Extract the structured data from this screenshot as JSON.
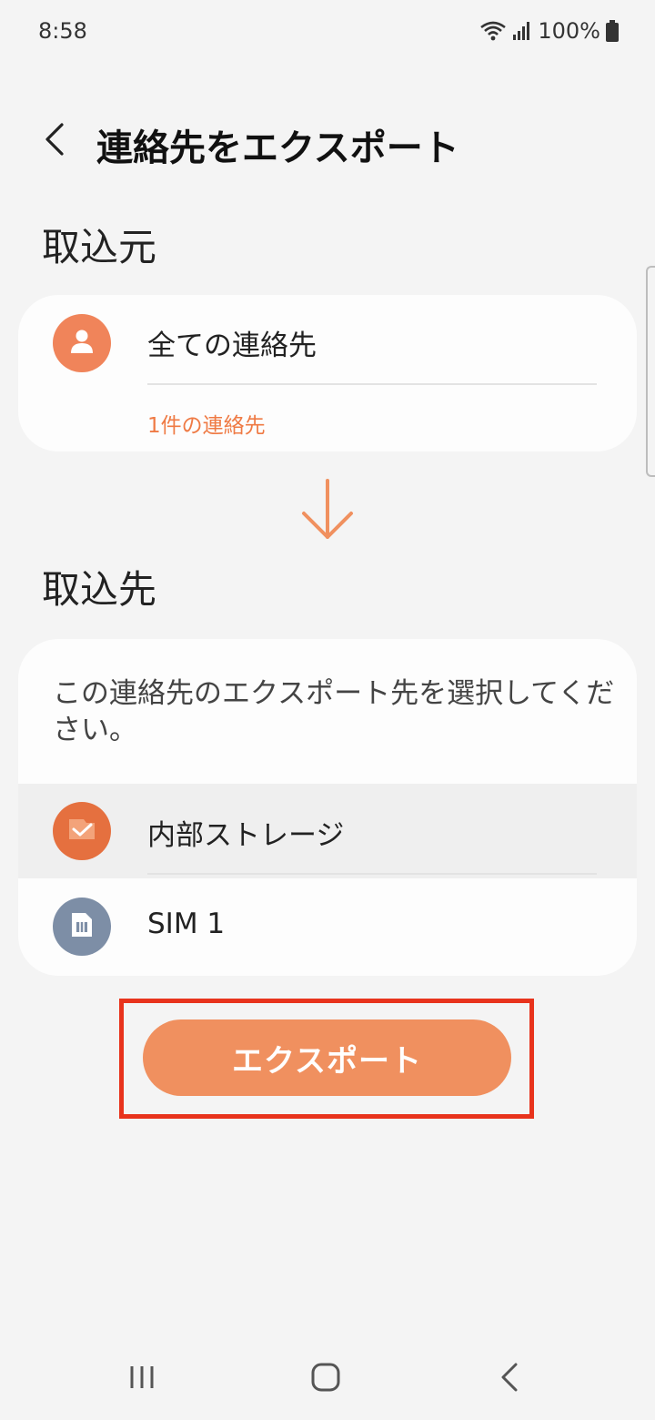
{
  "status_bar": {
    "time": "8:58",
    "battery": "100%",
    "icons": [
      "wifi-icon",
      "signal-icon",
      "battery-icon"
    ]
  },
  "header": {
    "title": "連絡先をエクスポート",
    "back_icon": "back-chevron-icon"
  },
  "source": {
    "section_title": "取込元",
    "item_label": "全ての連絡先",
    "item_count": "1件の連絡先",
    "icon": "person-icon"
  },
  "destination": {
    "section_title": "取込先",
    "description": "この連絡先のエクスポート先を選択してください。",
    "options": [
      {
        "label": "内部ストレージ",
        "icon": "check-icon",
        "selected": true
      },
      {
        "label": "SIM 1",
        "icon": "sim-card-icon",
        "selected": false
      }
    ]
  },
  "export_button": {
    "label": "エクスポート"
  },
  "colors": {
    "accent": "#f0905f",
    "accent_text": "#ef7a44",
    "highlight": "#e8331c",
    "background": "#f4f4f4",
    "sim_icon": "#7d8ea6"
  },
  "nav_bar": {
    "buttons": [
      "recent-apps-icon",
      "home-icon",
      "back-icon"
    ]
  }
}
